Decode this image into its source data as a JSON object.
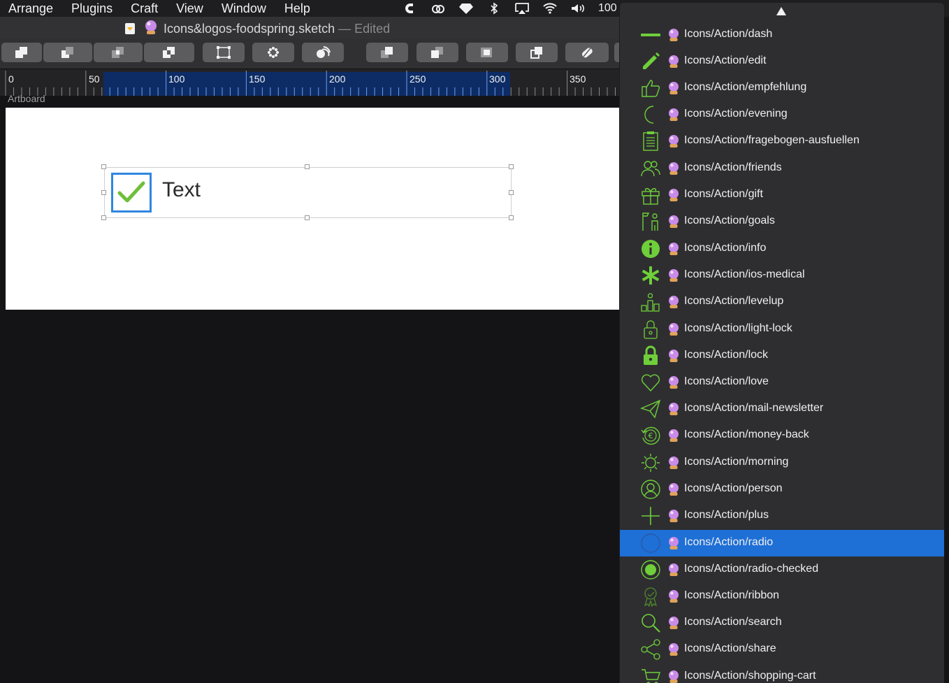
{
  "menubar": {
    "items": [
      "Arrange",
      "Plugins",
      "Craft",
      "View",
      "Window",
      "Help"
    ],
    "tray_icons": [
      "creative-cloud-icon",
      "adobe-cc-icon",
      "sketch-icon",
      "bluetooth-icon",
      "airplay-icon",
      "wifi-icon",
      "volume-icon"
    ],
    "battery_text": "100"
  },
  "titlebar": {
    "filename": "Icons&logos-foodspring.sketch",
    "separator": " — ",
    "status": "Edited"
  },
  "toolbar": {
    "buttons": [
      "union-icon",
      "subtract-icon",
      "intersect-icon",
      "difference-icon",
      "transform-icon",
      "rotate-copies-icon",
      "flatten-icon",
      "forward-icon",
      "backward-icon",
      "mask-icon",
      "scissors-icon",
      "edit-icon"
    ]
  },
  "ruler": {
    "labels": [
      "0",
      "50",
      "100",
      "150",
      "200",
      "250",
      "300",
      "350"
    ]
  },
  "canvas": {
    "artboard_label": "Artboard",
    "component_text": "Text"
  },
  "dropdown": {
    "accent_color": "#6fcf3a",
    "selected_color": "#1e6fd6",
    "items": [
      {
        "label": "Icons/Action/dash",
        "icon": "dash-icon"
      },
      {
        "label": "Icons/Action/edit",
        "icon": "pencil-icon"
      },
      {
        "label": "Icons/Action/empfehlung",
        "icon": "thumbs-up-icon"
      },
      {
        "label": "Icons/Action/evening",
        "icon": "moon-icon"
      },
      {
        "label": "Icons/Action/fragebogen-ausfuellen",
        "icon": "clipboard-icon"
      },
      {
        "label": "Icons/Action/friends",
        "icon": "friends-icon"
      },
      {
        "label": "Icons/Action/gift",
        "icon": "gift-icon"
      },
      {
        "label": "Icons/Action/goals",
        "icon": "goals-icon"
      },
      {
        "label": "Icons/Action/info",
        "icon": "info-icon"
      },
      {
        "label": "Icons/Action/ios-medical",
        "icon": "asterisk-icon"
      },
      {
        "label": "Icons/Action/levelup",
        "icon": "levelup-icon"
      },
      {
        "label": "Icons/Action/light-lock",
        "icon": "light-lock-icon"
      },
      {
        "label": "Icons/Action/lock",
        "icon": "lock-icon"
      },
      {
        "label": "Icons/Action/love",
        "icon": "heart-icon"
      },
      {
        "label": "Icons/Action/mail-newsletter",
        "icon": "paper-plane-icon"
      },
      {
        "label": "Icons/Action/money-back",
        "icon": "money-back-icon"
      },
      {
        "label": "Icons/Action/morning",
        "icon": "sun-icon"
      },
      {
        "label": "Icons/Action/person",
        "icon": "person-icon"
      },
      {
        "label": "Icons/Action/plus",
        "icon": "plus-icon"
      },
      {
        "label": "Icons/Action/radio",
        "icon": "radio-icon",
        "selected": true
      },
      {
        "label": "Icons/Action/radio-checked",
        "icon": "radio-checked-icon"
      },
      {
        "label": "Icons/Action/ribbon",
        "icon": "ribbon-icon"
      },
      {
        "label": "Icons/Action/search",
        "icon": "search-icon"
      },
      {
        "label": "Icons/Action/share",
        "icon": "share-icon"
      },
      {
        "label": "Icons/Action/shopping-cart",
        "icon": "cart-icon"
      }
    ]
  }
}
